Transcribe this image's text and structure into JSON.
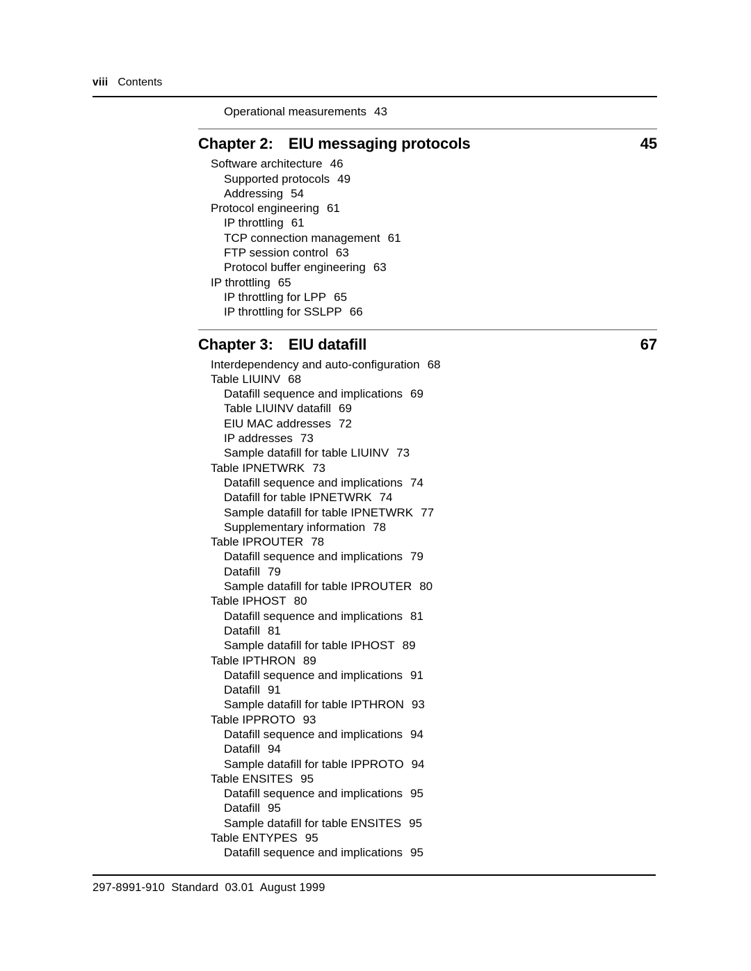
{
  "header": {
    "folio": "viii",
    "title": "Contents"
  },
  "pre_entries": [
    {
      "label": "Operational measurements",
      "page": "43",
      "level": 2
    }
  ],
  "chapters": [
    {
      "number_label": "Chapter 2:",
      "title": "EIU messaging protocols",
      "page": "45",
      "entries": [
        {
          "label": "Software architecture",
          "page": "46",
          "level": 1
        },
        {
          "label": "Supported protocols",
          "page": "49",
          "level": 2
        },
        {
          "label": "Addressing",
          "page": "54",
          "level": 2
        },
        {
          "label": "Protocol engineering",
          "page": "61",
          "level": 1
        },
        {
          "label": "IP throttling",
          "page": "61",
          "level": 2
        },
        {
          "label": "TCP connection management",
          "page": "61",
          "level": 2
        },
        {
          "label": "FTP session control",
          "page": "63",
          "level": 2
        },
        {
          "label": "Protocol buffer engineering",
          "page": "63",
          "level": 2
        },
        {
          "label": "IP throttling",
          "page": "65",
          "level": 1
        },
        {
          "label": "IP throttling for LPP",
          "page": "65",
          "level": 2
        },
        {
          "label": "IP throttling for SSLPP",
          "page": "66",
          "level": 2
        }
      ]
    },
    {
      "number_label": "Chapter 3:",
      "title": "EIU datafill",
      "page": "67",
      "entries": [
        {
          "label": "Interdependency and auto-configuration",
          "page": "68",
          "level": 1
        },
        {
          "label": "Table LIUINV",
          "page": "68",
          "level": 1
        },
        {
          "label": "Datafill sequence and implications",
          "page": "69",
          "level": 2
        },
        {
          "label": "Table LIUINV datafill",
          "page": "69",
          "level": 2
        },
        {
          "label": "EIU MAC addresses",
          "page": "72",
          "level": 2
        },
        {
          "label": "IP addresses",
          "page": "73",
          "level": 2
        },
        {
          "label": "Sample datafill for table LIUINV",
          "page": "73",
          "level": 2
        },
        {
          "label": "Table IPNETWRK",
          "page": "73",
          "level": 1
        },
        {
          "label": "Datafill sequence and implications",
          "page": "74",
          "level": 2
        },
        {
          "label": "Datafill for table IPNETWRK",
          "page": "74",
          "level": 2
        },
        {
          "label": "Sample datafill for table IPNETWRK",
          "page": "77",
          "level": 2
        },
        {
          "label": "Supplementary information",
          "page": "78",
          "level": 2
        },
        {
          "label": "Table IPROUTER",
          "page": "78",
          "level": 1
        },
        {
          "label": "Datafill sequence and implications",
          "page": "79",
          "level": 2
        },
        {
          "label": "Datafill",
          "page": "79",
          "level": 2
        },
        {
          "label": "Sample datafill for table IPROUTER",
          "page": "80",
          "level": 2
        },
        {
          "label": "Table IPHOST",
          "page": "80",
          "level": 1
        },
        {
          "label": "Datafill sequence and implications",
          "page": "81",
          "level": 2
        },
        {
          "label": "Datafill",
          "page": "81",
          "level": 2
        },
        {
          "label": "Sample datafill for table IPHOST",
          "page": "89",
          "level": 2
        },
        {
          "label": "Table IPTHRON",
          "page": "89",
          "level": 1
        },
        {
          "label": "Datafill sequence and implications",
          "page": "91",
          "level": 2
        },
        {
          "label": "Datafill",
          "page": "91",
          "level": 2
        },
        {
          "label": "Sample datafill for table IPTHRON",
          "page": "93",
          "level": 2
        },
        {
          "label": "Table IPPROTO",
          "page": "93",
          "level": 1
        },
        {
          "label": "Datafill sequence and implications",
          "page": "94",
          "level": 2
        },
        {
          "label": "Datafill",
          "page": "94",
          "level": 2
        },
        {
          "label": "Sample datafill for table IPPROTO",
          "page": "94",
          "level": 2
        },
        {
          "label": "Table ENSITES",
          "page": "95",
          "level": 1
        },
        {
          "label": "Datafill sequence and implications",
          "page": "95",
          "level": 2
        },
        {
          "label": "Datafill",
          "page": "95",
          "level": 2
        },
        {
          "label": "Sample datafill for table ENSITES",
          "page": "95",
          "level": 2
        },
        {
          "label": "Table ENTYPES",
          "page": "95",
          "level": 1
        },
        {
          "label": "Datafill sequence and implications",
          "page": "95",
          "level": 2
        }
      ]
    }
  ],
  "footer": {
    "text": "297-8991-910  Standard  03.01  August 1999"
  }
}
